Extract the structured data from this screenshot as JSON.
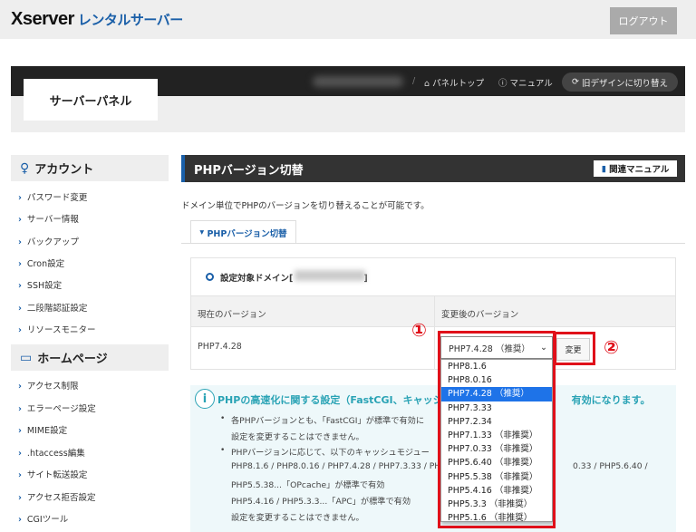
{
  "header": {
    "logo_main": "Xserver",
    "logo_sub": "レンタルサーバー",
    "logout": "ログアウト"
  },
  "panelbar": {
    "title": "サーバーパネル",
    "links": [
      "パネルトップ",
      "マニュアル"
    ],
    "old_design": "旧デザインに切り替え"
  },
  "sidebar": {
    "sections": [
      {
        "title": "アカウント",
        "icon": "user-icon",
        "items": [
          "パスワード変更",
          "サーバー情報",
          "バックアップ",
          "Cron設定",
          "SSH設定",
          "二段階認証設定",
          "リソースモニター"
        ]
      },
      {
        "title": "ホームページ",
        "icon": "window-icon",
        "items": [
          "アクセス制限",
          "エラーページ設定",
          "MIME設定",
          ".htaccess編集",
          "サイト転送設定",
          "アクセス拒否設定",
          "CGIツール"
        ]
      }
    ]
  },
  "main": {
    "title": "PHPバージョン切替",
    "manual_button": "関連マニュアル",
    "description": "ドメイン単位でPHPのバージョンを切り替えることが可能です。",
    "tab": "PHPバージョン切替",
    "domain_label": "設定対象ドメイン[",
    "domain_close": "]",
    "col_current": "現在のバージョン",
    "col_new": "変更後のバージョン",
    "current_version": "PHP7.4.28",
    "selected_version": "PHP7.4.28 （推奨）",
    "change_button": "変更",
    "options": [
      "PHP8.1.6",
      "PHP8.0.16",
      "PHP7.4.28 （推奨）",
      "PHP7.3.33",
      "PHP7.2.34",
      "PHP7.1.33 （非推奨）",
      "PHP7.0.33 （非推奨）",
      "PHP5.6.40 （非推奨）",
      "PHP5.5.38 （非推奨）",
      "PHP5.4.16 （非推奨）",
      "PHP5.3.3 （非推奨）",
      "PHP5.1.6 （非推奨）"
    ],
    "highlighted_option": "PHP7.4.28 （推奨）",
    "annotations": [
      "①",
      "②"
    ]
  },
  "info": {
    "title_left": "PHPの高速化に関する設定（FastCGI、キャッシ",
    "title_right": "有効になります。",
    "bullet1_line1": "各PHPバージョンとも、「FastCGI」が標準で有効に",
    "bullet1_line2": "設定を変更することはできません。",
    "bullet2_line1": "PHPバージョンに応じて、以下のキャッシュモジュー",
    "bullet2_line2_left": "PHP8.1.6 / PHP8.0.16 / PHP7.4.28 / PHP7.3.33 / PH",
    "bullet2_line2_right": "0.33 / PHP5.6.40 /",
    "bullet2_line3": "PHP5.5.38...「OPcache」が標準で有効",
    "bullet2_line4": "PHP5.4.16 / PHP5.3.3...「APC」が標準で有効",
    "bullet2_line5": "設定を変更することはできません。"
  },
  "colors": {
    "accent": "#1a5fa8",
    "highlight": "#1e73e8",
    "annotation": "#e0101a",
    "info": "#2aa3b5"
  }
}
